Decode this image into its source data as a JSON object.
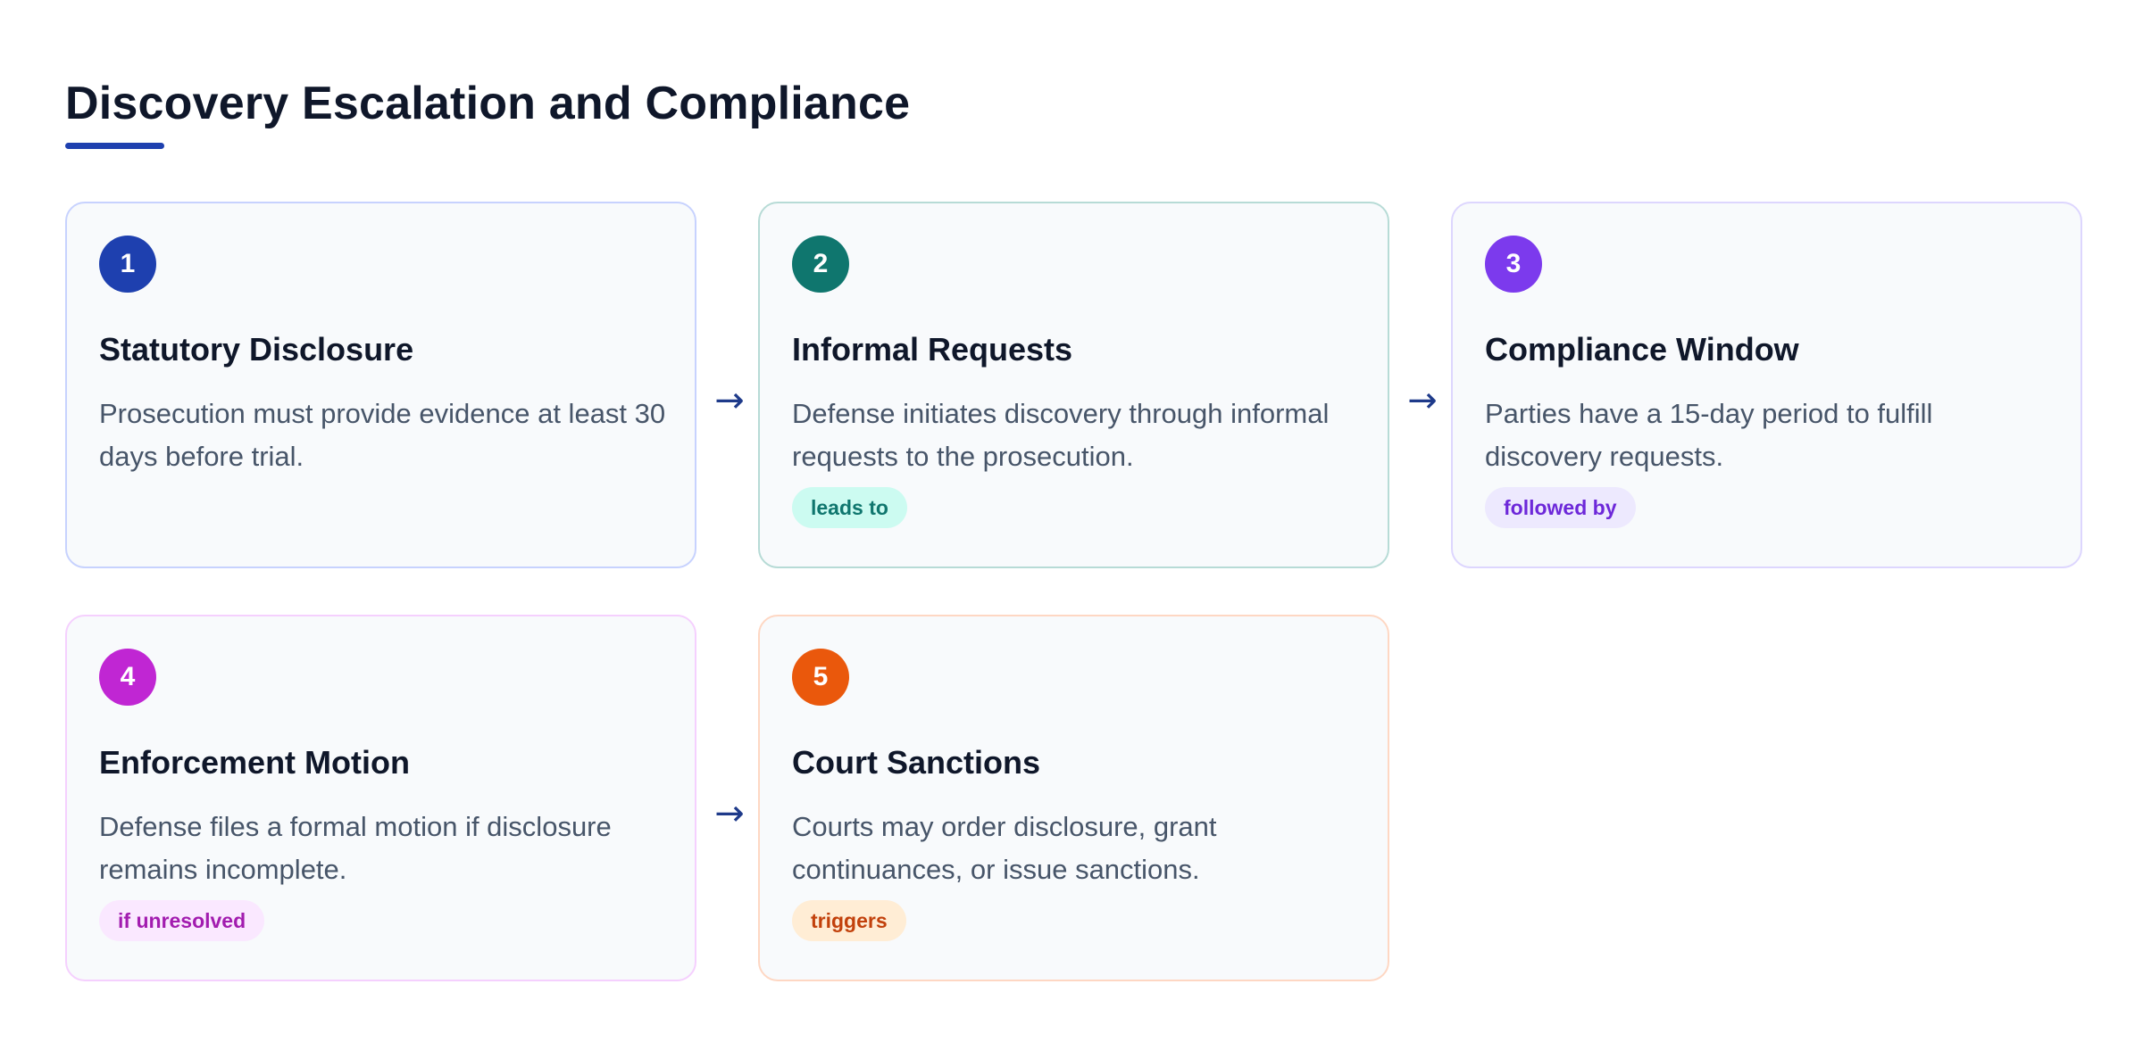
{
  "title": "Discovery Escalation and Compliance",
  "arrow_glyph": "→",
  "steps": [
    {
      "number": "1",
      "title": "Statutory Disclosure",
      "description": "Prosecution must provide evidence at least 30 days before trial.",
      "tag": "",
      "color": "#1e40af",
      "border_color": "#c7d2fe",
      "tag_bg": "",
      "tag_text_color": ""
    },
    {
      "number": "2",
      "title": "Informal Requests",
      "description": "Defense initiates discovery through informal requests to the prosecution.",
      "tag": "leads to",
      "color": "#0f766e",
      "border_color": "#b7dbd6",
      "tag_bg": "#ccfbf1",
      "tag_text_color": "#0f766e"
    },
    {
      "number": "3",
      "title": "Compliance Window",
      "description": "Parties have a 15-day period to fulfill discovery requests.",
      "tag": "followed by",
      "color": "#7c3aed",
      "border_color": "#ddd6fe",
      "tag_bg": "#ede9fe",
      "tag_text_color": "#6d28d9"
    },
    {
      "number": "4",
      "title": "Enforcement Motion",
      "description": "Defense files a formal motion if disclosure remains incomplete.",
      "tag": "if unresolved",
      "color": "#c026d3",
      "border_color": "#f5d0fe",
      "tag_bg": "#fae8ff",
      "tag_text_color": "#a21caf"
    },
    {
      "number": "5",
      "title": "Court Sanctions",
      "description": "Courts may order disclosure, grant continuances, or issue sanctions.",
      "tag": "triggers",
      "color": "#ea580c",
      "border_color": "#fed7c3",
      "tag_bg": "#ffedd5",
      "tag_text_color": "#c2410c"
    }
  ]
}
